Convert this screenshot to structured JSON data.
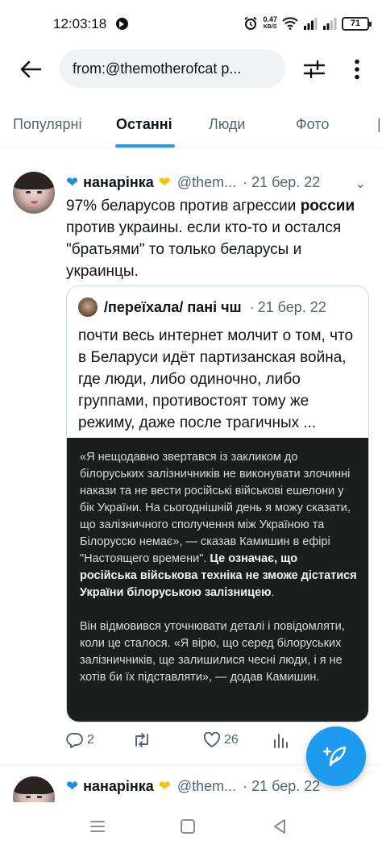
{
  "status_bar": {
    "time": "12:03:18",
    "net_speed_value": "0.47",
    "net_speed_unit": "KB/S",
    "battery": "71"
  },
  "search": {
    "query": "from:@themotherofcat p..."
  },
  "tabs": [
    {
      "label": "Популярні",
      "active": false
    },
    {
      "label": "Останні",
      "active": true
    },
    {
      "label": "Люди",
      "active": false
    },
    {
      "label": "Фото",
      "active": false
    }
  ],
  "tweets": [
    {
      "author_name": "нанарінка",
      "handle": "@them...",
      "date": "· 21 бер. 22",
      "text_parts": [
        "97% беларусов против агрессии ",
        "россии",
        " против украины. если кто-то и остался \"братьями\" то только беларусы и украинцы."
      ],
      "quote": {
        "author_name": "/переїхала/ пані чш",
        "date": "21 бер. 22",
        "text": "почти весь интернет молчит о том, что в Беларуси идёт партизанская война, где люди, либо одиночно, либо группами, противостоят тому же режиму, даже после трагичных ...",
        "image_text": {
          "p1_plain": "«Я нещодавно звертався із закликом до білоруських залізничників не виконувати злочинні накази та не вести російські військові ешелони у бік України. На сьогоднішній день я можу сказати, що залізничного сполучення між Україною та Білоруссю немає», — сказав Камишин в ефірі \"Настоящего времени\". ",
          "p1_bold": "Це означає, що російська військова техніка не зможе дістатися України білоруською залізницею",
          "p1_end": ".",
          "p2": "Він відмовився уточнювати деталі і повідомляти, коли це сталося. «Я вірю, що серед білоруських залізничників, ще залишилися чесні люди, і я не хотів би їх підставляти», — додав Камишин."
        }
      },
      "actions": {
        "replies": "2",
        "retweets": "",
        "likes": "26"
      }
    },
    {
      "author_name": "нанарінка",
      "handle": "@them...",
      "date": "· 21 бер. 22"
    }
  ],
  "icons": {
    "back": "arrow-left-icon",
    "filter": "sliders-icon",
    "more": "more-vertical-icon",
    "fab": "compose-feather-icon"
  },
  "colors": {
    "accent": "#1d9bf0",
    "text_primary": "#0f1419",
    "text_secondary": "#536471"
  }
}
